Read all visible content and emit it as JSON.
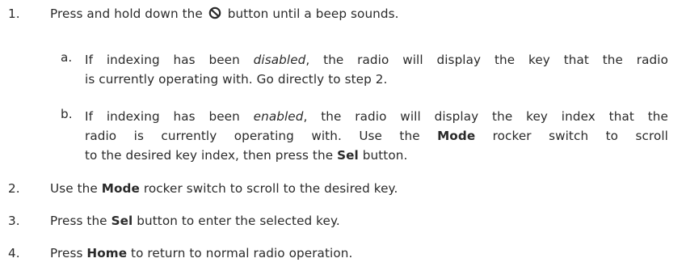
{
  "steps": [
    {
      "number": "1.",
      "text_before_icon": "Press and hold down the",
      "icon": "power-off-circle-slash-icon",
      "text_after_icon": "button until a beep sounds.",
      "substeps": [
        {
          "letter": "a.",
          "line1_pre": "If indexing has been",
          "line1_em": "disabled",
          "line1_post": ", the radio will display the key that the radio",
          "line2": "is currently operating with. Go directly to step 2."
        },
        {
          "letter": "b.",
          "line1_pre": "If indexing has been",
          "line1_em": "enabled",
          "line1_post": ", the radio will display the key index that the",
          "line2_pre": "radio is currently operating with. Use the",
          "line2_bold": "Mode",
          "line2_post": "rocker switch to scroll",
          "line3_pre": "to the desired key index, then press the",
          "line3_bold": "Sel",
          "line3_post": "button."
        }
      ]
    },
    {
      "number": "2.",
      "pre": "Use the",
      "bold": "Mode",
      "post": "rocker switch to scroll to the desired key."
    },
    {
      "number": "3.",
      "pre": "Press the",
      "bold": "Sel",
      "post": "button to enter the selected key."
    },
    {
      "number": "4.",
      "pre": "Press",
      "bold": "Home",
      "post": "to return to normal radio operation."
    }
  ]
}
